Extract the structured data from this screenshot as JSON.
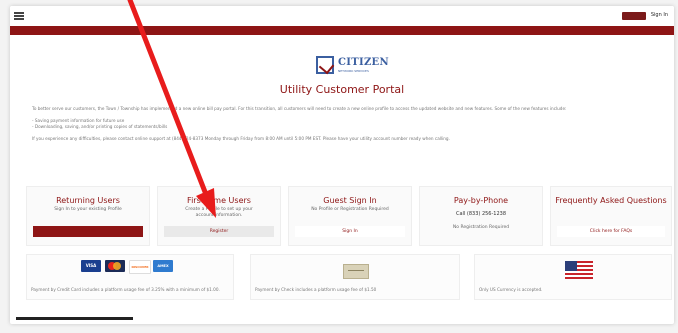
{
  "header": {
    "top_button_label": "",
    "signin_label": "Sign In"
  },
  "logo": {
    "text": "CITIZEN",
    "subtext": "NETWORK SERVICES"
  },
  "portal_title": "Utility Customer Portal",
  "intro": {
    "paragraph": "To better serve our customers, the Town / Township has implemented a new online bill pay portal. For this transition, all customers will need to create a new online profile to access the updated website and new features. Some of the new features include:",
    "bullets": [
      "- Saving payment information for future use",
      "- Downloading, saving, and/or printing copies of statements/bills"
    ],
    "help": "If you experience any difficulties, please contact online support at (844)824-8373 Monday through Friday from 8:00 AM until 5:00 PM EST. Please have your utility account number ready when calling."
  },
  "cards": [
    {
      "title": "Returning Users",
      "desc": "Sign In to your existing Profile",
      "button": "Sign In"
    },
    {
      "title": "First Time Users",
      "desc": "Create a Profile to set up your account information.",
      "button": "Register"
    },
    {
      "title": "Guest Sign In",
      "desc": "No Profile or Registration Required",
      "button": "Sign In"
    },
    {
      "title": "Pay-by-Phone",
      "phone": "Call (833) 256-1238",
      "note": "No Registration Required"
    },
    {
      "title": "Frequently Asked Questions",
      "button": "Click here for FAQs"
    }
  ],
  "payments": {
    "card_text": "Payment by Credit Card includes a platform usage fee of 3.25% with a minimum of $1.00.",
    "check_text": "Payment by Check includes a platform usage fee of $1.50",
    "currency_text": "Only US Currency is accepted.",
    "card_brands": [
      "VISA",
      "MC",
      "DISCOVER",
      "AMEX"
    ]
  },
  "colors": {
    "brand_red": "#8e1515",
    "brand_blue": "#3b5fa0",
    "annotation_arrow": "#e81c1c"
  }
}
